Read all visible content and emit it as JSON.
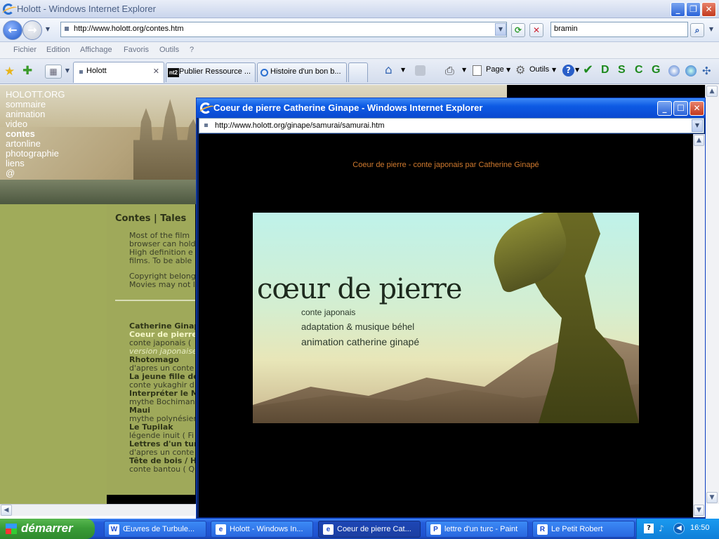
{
  "main_window": {
    "title": "Holott - Windows Internet Explorer",
    "address": "http://www.holott.org/contes.htm",
    "search_value": "bramin",
    "menu": [
      "Fichier",
      "Edition",
      "Affichage",
      "Favoris",
      "Outils",
      "?"
    ],
    "tabs": [
      {
        "label": "Holott",
        "active": true
      },
      {
        "label": "Publier Ressource ...",
        "active": false
      },
      {
        "label": "Histoire d'un bon b...",
        "active": false
      }
    ],
    "commands": {
      "page": "Page",
      "tools": "Outils"
    },
    "quick_letters": [
      "D",
      "S",
      "C",
      "G"
    ]
  },
  "page": {
    "nav": [
      "HOLOTT.ORG",
      "sommaire",
      "animation",
      "video",
      "contes",
      "artonline",
      "photographie",
      "liens",
      "@"
    ],
    "current_nav": "contes",
    "section_title": "Contes | Tales",
    "intro_lines": [
      "Most of the film",
      "browser can hold",
      "High definition e",
      "films. To be able"
    ],
    "copyright_lines": [
      "Copyright belong",
      "Movies may not l"
    ],
    "list": [
      {
        "text": "Catherine Ginapé",
        "style": "b"
      },
      {
        "text": "Coeur de pierre",
        "style": "hl"
      },
      {
        "text": "conte japonais (",
        "style": ""
      },
      {
        "text": "version japonaise",
        "style": "i"
      },
      {
        "text": "Rhotomago",
        "style": "b"
      },
      {
        "text": "d'apres un conte",
        "style": ""
      },
      {
        "text": "La jeune fille de l",
        "style": "b"
      },
      {
        "text": "conte yukaghir d",
        "style": ""
      },
      {
        "text": "Interpréter le Mo",
        "style": "b"
      },
      {
        "text": "mythe Bochiman",
        "style": ""
      },
      {
        "text": "Maui",
        "style": "b"
      },
      {
        "text": "mythe polynésien",
        "style": ""
      },
      {
        "text": "Le Tupilak",
        "style": "b"
      },
      {
        "text": "légende inuit ( Fi",
        "style": ""
      },
      {
        "text": "Lettres d'un turc",
        "style": "b"
      },
      {
        "text": "d'apres un conte",
        "style": ""
      },
      {
        "text": "Tête de bois / Ha",
        "style": "b"
      },
      {
        "text": "conte bantou ( Q",
        "style": ""
      }
    ]
  },
  "popup": {
    "title": "Coeur de pierre Catherine Ginape - Windows Internet Explorer",
    "address": "http://www.holott.org/ginape/samurai/samurai.htm",
    "subtitle": "Coeur de pierre - conte japonais par Catherine Ginapé",
    "film_title": "cœur de pierre",
    "film_lines": [
      "conte japonais",
      "adaptation & musique béhel",
      "animation catherine ginapé"
    ]
  },
  "taskbar": {
    "start_label": "démarrer",
    "tasks": [
      {
        "label": "Œuvres de Turbule...",
        "icon": "W",
        "active": false
      },
      {
        "label": "Holott - Windows In...",
        "icon": "e",
        "active": false
      },
      {
        "label": "Coeur de pierre Cat...",
        "icon": "e",
        "active": true
      },
      {
        "label": "lettre d'un turc - Paint",
        "icon": "P",
        "active": false
      },
      {
        "label": "Le Petit Robert",
        "icon": "R",
        "active": false
      }
    ],
    "clock": "16:50"
  }
}
